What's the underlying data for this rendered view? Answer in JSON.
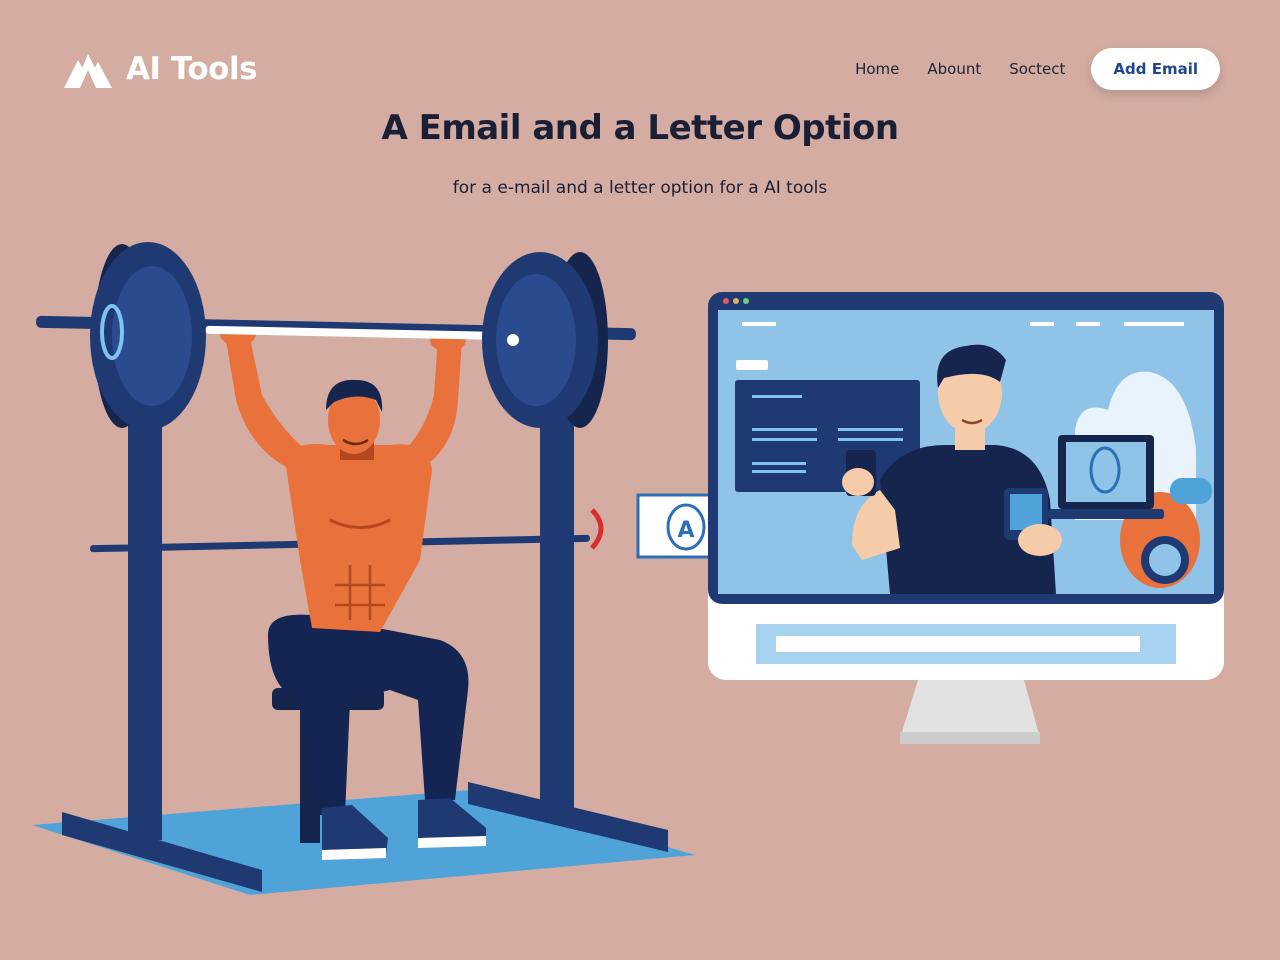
{
  "brand": {
    "name": "AI Tools",
    "logo_icon": "mountain-logo-icon"
  },
  "nav": {
    "items": [
      "Home",
      "Abount",
      "Soctect"
    ],
    "cta_label": "Add Email"
  },
  "hero": {
    "title": "A Email and a Letter Option",
    "subtitle": "for a e-mail and a letter option for a AI tools"
  },
  "colors": {
    "background": "#d4aca2",
    "navy": "#1f3a72",
    "skin": "#e8713c",
    "mat": "#4fa3d8",
    "screen": "#8fc4e8"
  },
  "illustration": {
    "left_icon": "weightlifter-illustration",
    "right_icon": "monitor-video-call-illustration",
    "badge_icon": "ai-badge-icon",
    "badge_text": "A"
  }
}
